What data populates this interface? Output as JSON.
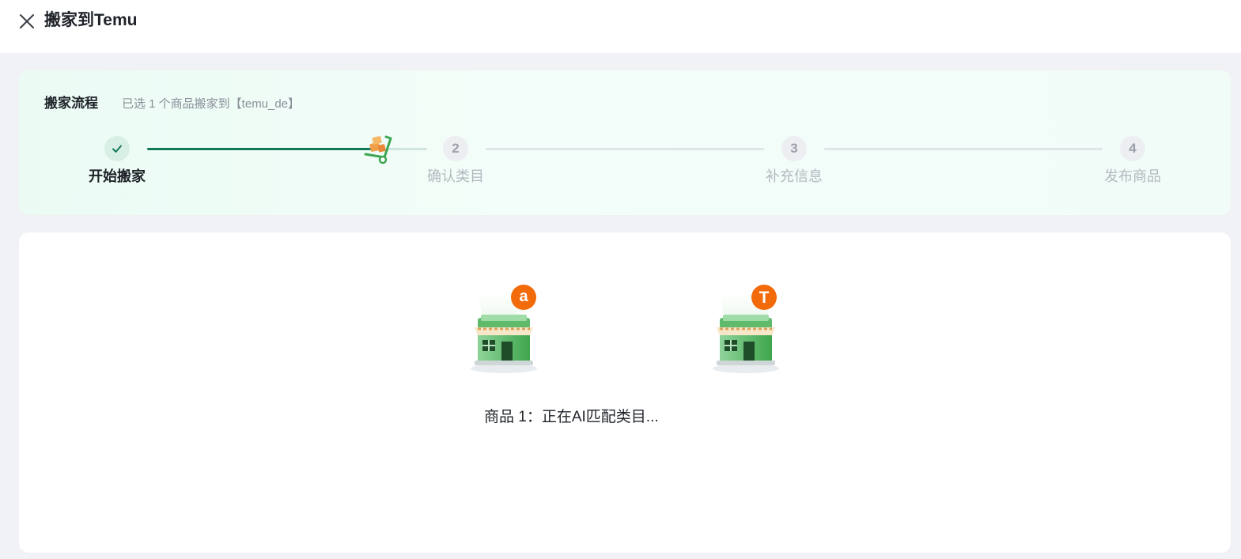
{
  "header": {
    "title": "搬家到Temu",
    "close_icon": "close-icon"
  },
  "flow": {
    "title": "搬家流程",
    "subtitle": "已选 1 个商品搬家到【temu_de】",
    "progress_to_step2_fraction": 0.83,
    "steps": [
      {
        "number": "",
        "label": "开始搬家",
        "status": "done"
      },
      {
        "number": "2",
        "label": "确认类目",
        "status": "todo"
      },
      {
        "number": "3",
        "label": "补充信息",
        "status": "todo"
      },
      {
        "number": "4",
        "label": "发布商品",
        "status": "todo"
      }
    ]
  },
  "migration": {
    "source_store_badge": "a",
    "target_store_badge": "T",
    "status_text": "商品 1：正在AI匹配类目..."
  },
  "colors": {
    "accent": "#13795b",
    "badge": "#f36a0a",
    "shop_green": "#3fa64d"
  }
}
